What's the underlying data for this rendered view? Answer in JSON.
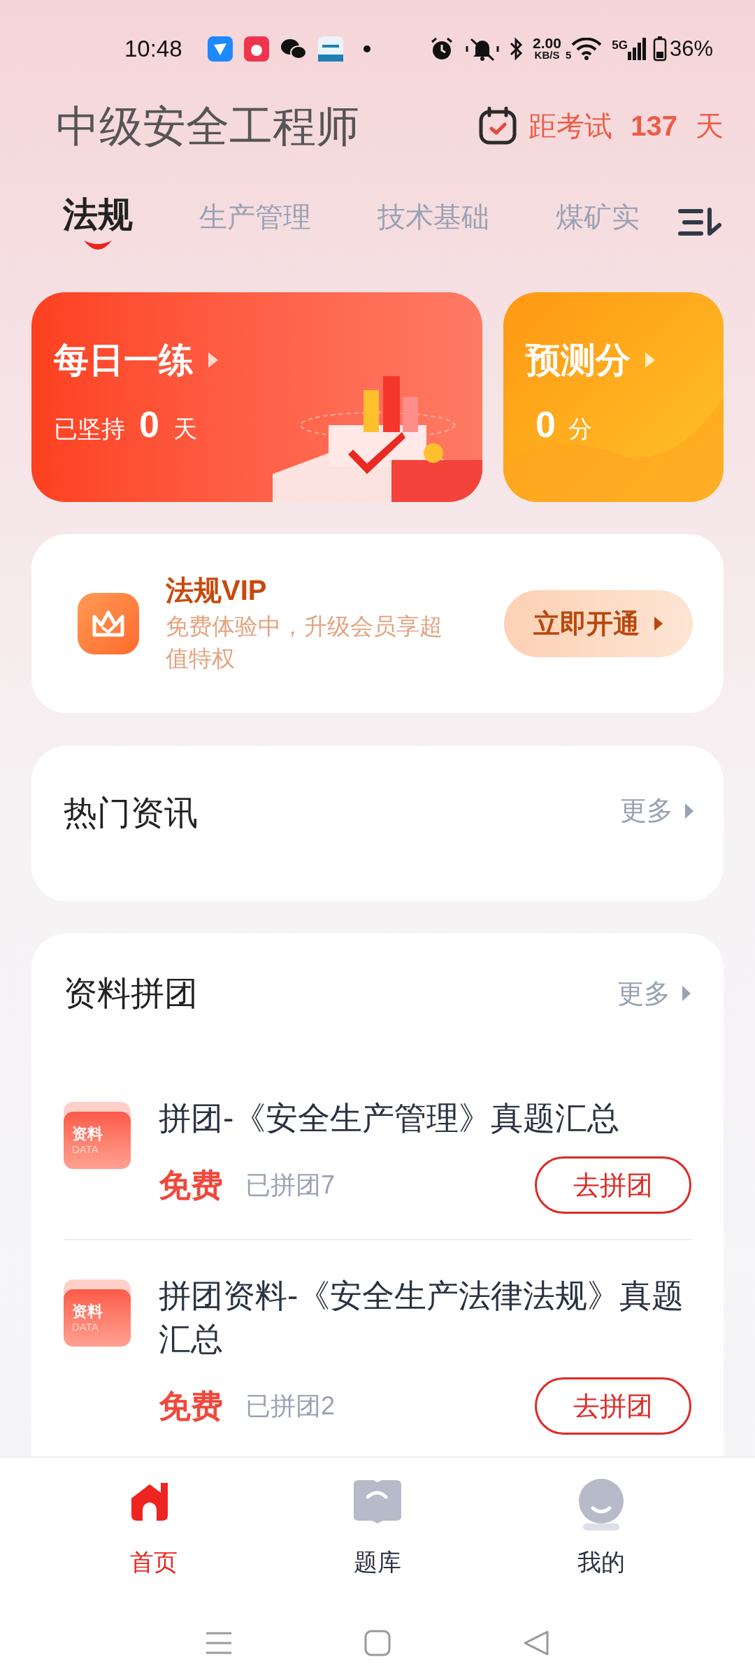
{
  "status_bar": {
    "time": "10:48",
    "network_speed": "2.00",
    "speed_unit": "KB/S",
    "wifi_badge": "5",
    "cellular": "5G",
    "battery": "36%"
  },
  "header": {
    "title": "中级安全工程师",
    "countdown_label": "距考试",
    "countdown_days": "137",
    "countdown_unit": "天"
  },
  "tabs": [
    {
      "label": "法规",
      "selected": true
    },
    {
      "label": "生产管理",
      "selected": false
    },
    {
      "label": "技术基础",
      "selected": false
    },
    {
      "label": "煤矿实",
      "selected": false
    }
  ],
  "daily_practice": {
    "title": "每日一练",
    "label": "已坚持",
    "value": "0",
    "unit": "天"
  },
  "predicted_score": {
    "title": "预测分",
    "value": "0",
    "unit": "分"
  },
  "vip": {
    "title": "法规VIP",
    "description": "免费体验中，升级会员享超值特权",
    "button": "立即开通"
  },
  "hot_news": {
    "title": "热门资讯",
    "more": "更多"
  },
  "group_buy": {
    "title": "资料拼团",
    "more": "更多",
    "items": [
      {
        "icon_label": "资料",
        "icon_sublabel": "DATA",
        "title": "拼团-《安全生产管理》真题汇总",
        "price": "免费",
        "joined": "已拼团7",
        "button": "去拼团"
      },
      {
        "icon_label": "资料",
        "icon_sublabel": "DATA",
        "title": "拼团资料-《安全生产法律法规》真题汇总",
        "price": "免费",
        "joined": "已拼团2",
        "button": "去拼团"
      }
    ]
  },
  "bottom_nav": [
    {
      "label": "首页",
      "selected": true,
      "kind": "home"
    },
    {
      "label": "题库",
      "selected": false,
      "kind": "book"
    },
    {
      "label": "我的",
      "selected": false,
      "kind": "profile"
    }
  ]
}
